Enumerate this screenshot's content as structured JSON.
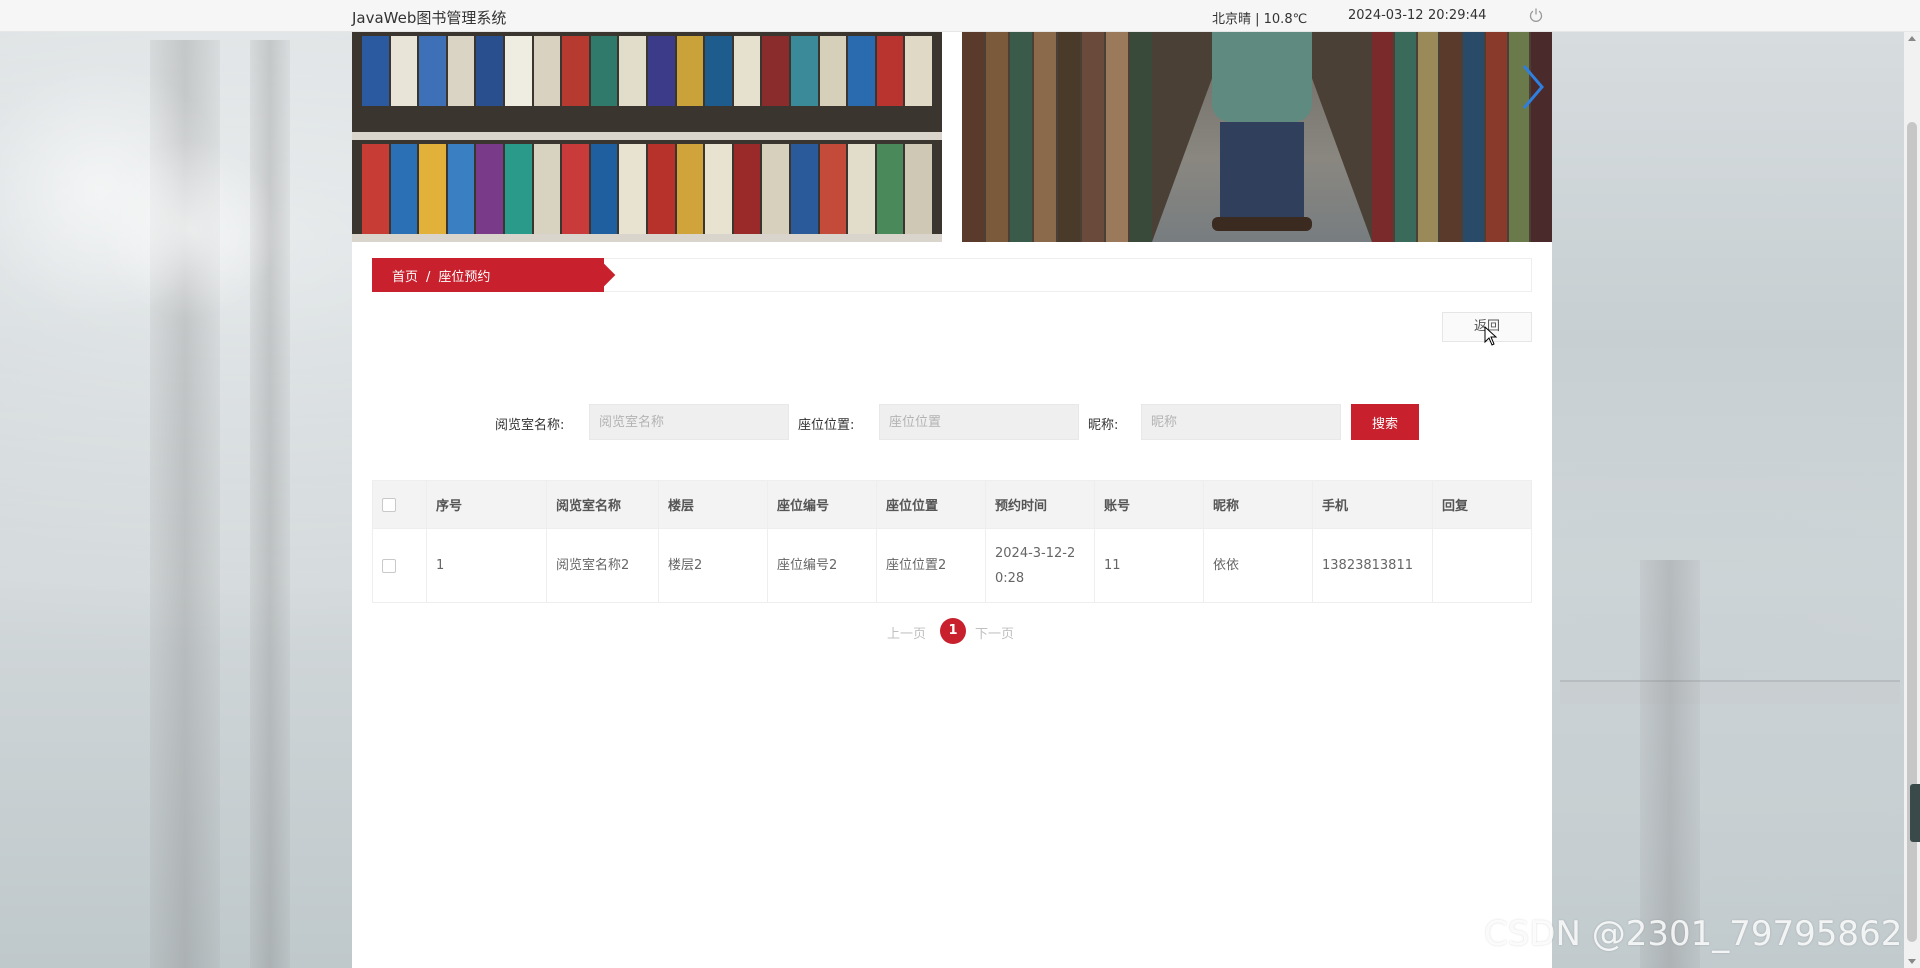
{
  "app": {
    "title": "JavaWeb图书管理系统"
  },
  "header": {
    "weather": "北京晴 | 10.8℃",
    "date": "2024-03-12",
    "time": "20:29:44"
  },
  "breadcrumb": {
    "home": "首页",
    "separator": "/",
    "current": "座位预约"
  },
  "back_button": {
    "label": "返回"
  },
  "search": {
    "fields": [
      {
        "label": "阅览室名称:",
        "placeholder": "阅览室名称",
        "value": ""
      },
      {
        "label": "座位位置:",
        "placeholder": "座位位置",
        "value": ""
      },
      {
        "label": "昵称:",
        "placeholder": "昵称",
        "value": ""
      }
    ],
    "button_label": "搜索"
  },
  "table": {
    "headers": [
      "序号",
      "阅览室名称",
      "楼层",
      "座位编号",
      "座位位置",
      "预约时间",
      "账号",
      "昵称",
      "手机",
      "回复"
    ],
    "rows": [
      [
        "1",
        "阅览室名称2",
        "楼层2",
        "座位编号2",
        "座位位置2",
        "2024-3-12-20:28",
        "11",
        "依依",
        "13823813811",
        ""
      ]
    ]
  },
  "pagination": {
    "prev": "上一页",
    "current": "1",
    "next": "下一页"
  },
  "watermark": "CSDN @2301_79795862",
  "colors": {
    "accent": "#c8202d",
    "header_bg": "#f6f6f6",
    "table_header_bg": "#f3f3f3"
  }
}
